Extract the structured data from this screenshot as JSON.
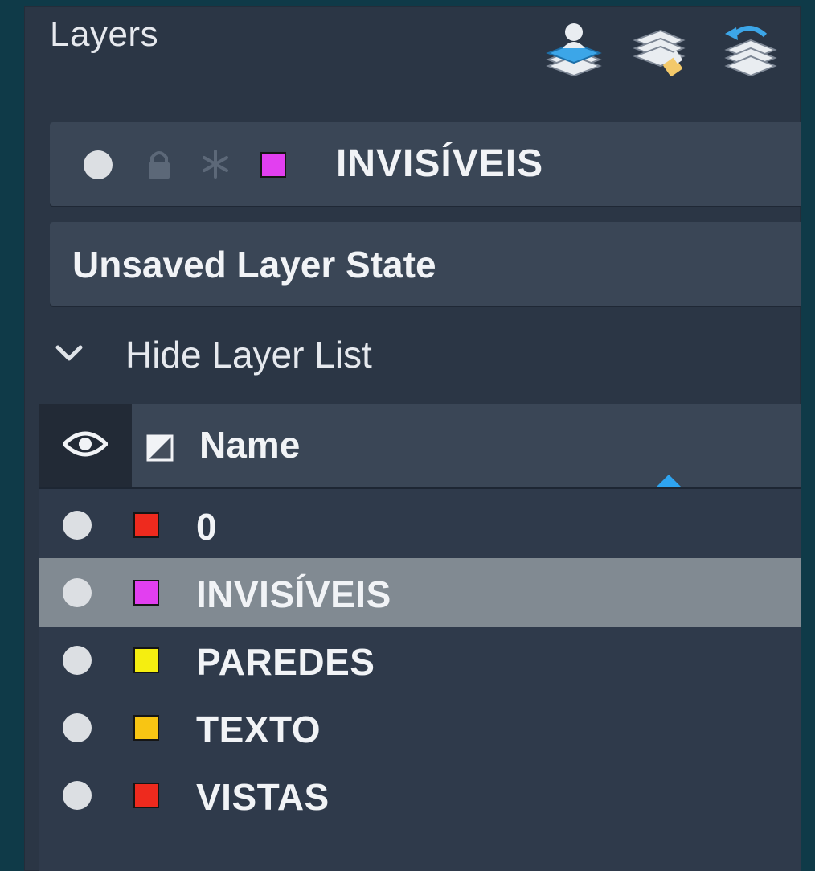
{
  "panel": {
    "title": "Layers",
    "header_icons": [
      "new-layer-icon",
      "layer-manager-icon",
      "restore-layer-state-icon"
    ]
  },
  "current_layer": {
    "name": "INVISÍVEIS",
    "color": "#e23ff0",
    "icons": [
      "visibility-dot-icon",
      "lock-icon",
      "freeze-icon"
    ]
  },
  "layer_state": {
    "label": "Unsaved Layer State"
  },
  "layer_list_toggle": {
    "label": "Hide Layer List",
    "icon": "chevron-down-icon"
  },
  "layer_list": {
    "columns": {
      "visibility_icon": "eye-icon",
      "color_icon": "color-column-icon",
      "name": "Name"
    },
    "selected_index": 1,
    "rows": [
      {
        "name": "0",
        "color": "#ee2a1e"
      },
      {
        "name": "INVISÍVEIS",
        "color": "#e23ff0"
      },
      {
        "name": "PAREDES",
        "color": "#f5ee10"
      },
      {
        "name": "TEXTO",
        "color": "#f8c513"
      },
      {
        "name": "VISTAS",
        "color": "#ee2a1e"
      }
    ]
  }
}
